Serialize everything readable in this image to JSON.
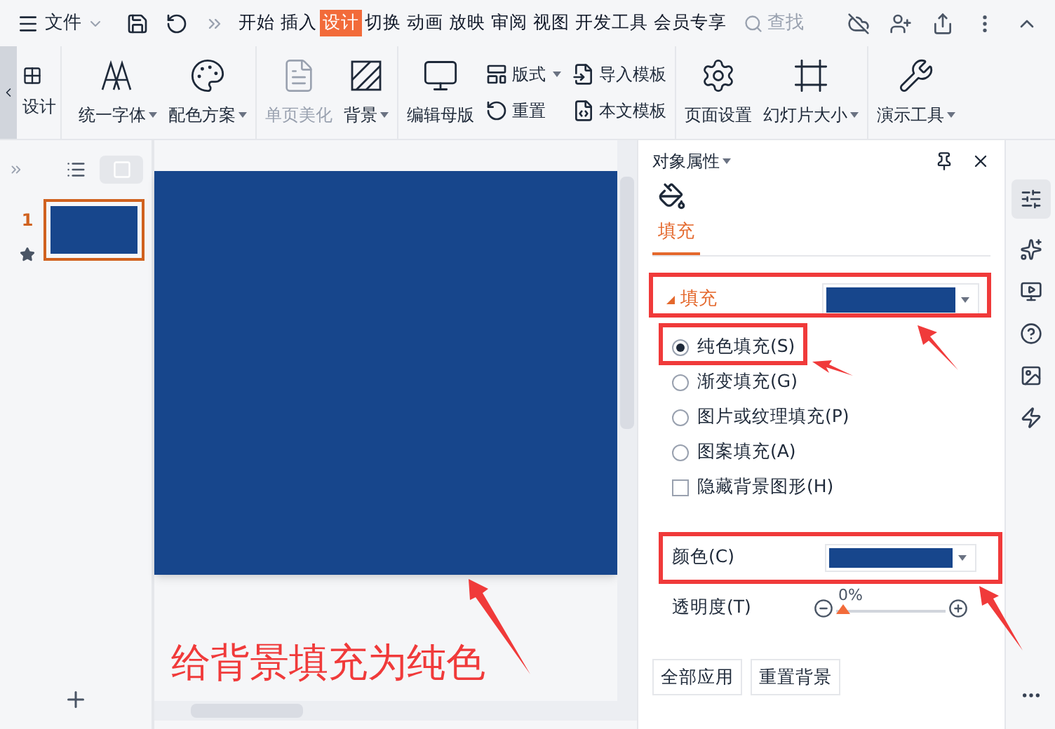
{
  "menu": {
    "label": "文件"
  },
  "tabs": [
    {
      "label": "开始",
      "selected": false
    },
    {
      "label": "插入",
      "selected": false
    },
    {
      "label": "设计",
      "selected": true
    },
    {
      "label": "切换",
      "selected": false
    },
    {
      "label": "动画",
      "selected": false
    },
    {
      "label": "放映",
      "selected": false
    },
    {
      "label": "审阅",
      "selected": false
    },
    {
      "label": "视图",
      "selected": false
    },
    {
      "label": "开发工具",
      "selected": false
    },
    {
      "label": "会员专享",
      "selected": false
    }
  ],
  "search": {
    "placeholder": "查找"
  },
  "ribbon": {
    "cut_label": "设计",
    "groups": [
      {
        "items": [
          {
            "kind": "large",
            "label": "统一字体",
            "dropdown": true,
            "disabled": false
          },
          {
            "kind": "large",
            "label": "配色方案",
            "dropdown": true,
            "disabled": false
          }
        ]
      },
      {
        "items": [
          {
            "kind": "large",
            "label": "单页美化",
            "dropdown": false,
            "disabled": true
          },
          {
            "kind": "large",
            "label": "背景",
            "dropdown": true,
            "disabled": false
          }
        ]
      },
      {
        "items": [
          {
            "kind": "large",
            "label": "编辑母版",
            "dropdown": false,
            "disabled": false
          },
          {
            "kind": "small",
            "label": "版式",
            "dropdown": true,
            "disabled": false
          },
          {
            "kind": "small",
            "label": "重置",
            "dropdown": false,
            "disabled": false
          },
          {
            "kind": "small",
            "label": "导入模板",
            "dropdown": false,
            "disabled": false
          },
          {
            "kind": "small",
            "label": "本文模板",
            "dropdown": false,
            "disabled": false
          }
        ]
      },
      {
        "items": [
          {
            "kind": "large",
            "label": "页面设置",
            "dropdown": false,
            "disabled": false
          },
          {
            "kind": "large",
            "label": "幻灯片大小",
            "dropdown": true,
            "disabled": false
          }
        ]
      },
      {
        "items": [
          {
            "kind": "large",
            "label": "演示工具",
            "dropdown": true,
            "disabled": false
          }
        ]
      }
    ]
  },
  "slides": [
    {
      "number": "1",
      "selected": true,
      "color": "#17468c"
    }
  ],
  "panel": {
    "title": "对象属性",
    "tabs": [
      {
        "label": "填充",
        "selected": true
      }
    ],
    "section": {
      "label": "填充",
      "expanded": true,
      "color": "#17468c"
    },
    "options": [
      {
        "kind": "radio",
        "label": "纯色填充(S)",
        "selected": true
      },
      {
        "kind": "radio",
        "label": "渐变填充(G)",
        "selected": false
      },
      {
        "kind": "radio",
        "label": "图片或纹理填充(P)",
        "selected": false
      },
      {
        "kind": "radio",
        "label": "图案填充(A)",
        "selected": false
      },
      {
        "kind": "checkbox",
        "label": "隐藏背景图形(H)",
        "checked": false
      }
    ],
    "color_row": {
      "label": "颜色(C)",
      "color": "#17468c"
    },
    "transparency": {
      "label": "透明度(T)",
      "reading": "0%",
      "level": 0
    },
    "buttons": [
      "全部应用",
      "重置背景"
    ]
  },
  "annotation": {
    "caption": "给背景填充为纯色"
  }
}
